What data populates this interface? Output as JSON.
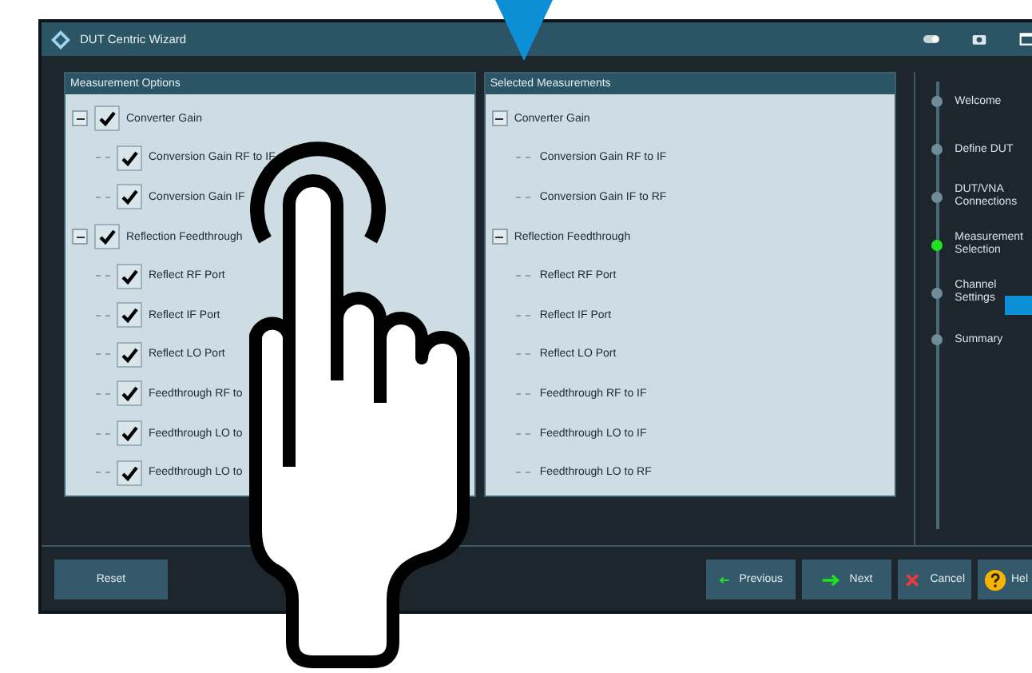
{
  "window": {
    "title": "DUT Centric Wizard"
  },
  "measurement_options": {
    "title": "Measurement Options",
    "items": [
      {
        "label": "Converter Gain",
        "checked": true,
        "expanded": true,
        "children": [
          {
            "label": "Conversion Gain RF to IF",
            "checked": true
          },
          {
            "label": "Conversion Gain IF",
            "checked": true
          }
        ]
      },
      {
        "label": "Reflection Feedthrough",
        "checked": true,
        "expanded": true,
        "children": [
          {
            "label": "Reflect RF Port",
            "checked": true
          },
          {
            "label": "Reflect IF Port",
            "checked": true
          },
          {
            "label": "Reflect LO Port",
            "checked": true
          },
          {
            "label": "Feedthrough RF to",
            "checked": true
          },
          {
            "label": "Feedthrough LO to",
            "checked": true
          },
          {
            "label": "Feedthrough LO to",
            "checked": true
          }
        ]
      }
    ]
  },
  "selected_measurements": {
    "title": "Selected Measurements",
    "items": [
      {
        "label": "Converter Gain",
        "expanded": true,
        "children": [
          {
            "label": "Conversion Gain RF to IF"
          },
          {
            "label": "Conversion Gain IF to RF"
          }
        ]
      },
      {
        "label": "Reflection Feedthrough",
        "expanded": true,
        "children": [
          {
            "label": "Reflect RF Port"
          },
          {
            "label": "Reflect IF Port"
          },
          {
            "label": "Reflect LO Port"
          },
          {
            "label": "Feedthrough RF to IF"
          },
          {
            "label": "Feedthrough LO to IF"
          },
          {
            "label": "Feedthrough LO to RF"
          }
        ]
      }
    ]
  },
  "steps": [
    {
      "label": "Welcome",
      "selected": false
    },
    {
      "label": "Define DUT",
      "selected": false
    },
    {
      "label": "DUT/VNA Connections",
      "selected": false
    },
    {
      "label": "Measurement Selection",
      "selected": true
    },
    {
      "label": "Channel Settings",
      "selected": false
    },
    {
      "label": "Summary",
      "selected": false
    }
  ],
  "buttons": [
    {
      "label": "Reset",
      "kind": "plain"
    },
    {
      "label": "Previous",
      "kind": "previous"
    },
    {
      "label": "Next",
      "kind": "next"
    },
    {
      "label": "Cancel",
      "kind": "cancel"
    },
    {
      "label": "Hel",
      "kind": "help"
    }
  ]
}
